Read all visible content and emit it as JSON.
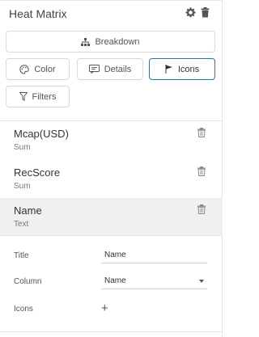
{
  "panel": {
    "title": "Heat Matrix",
    "header_icons": [
      "gear-icon",
      "trash-icon"
    ]
  },
  "buttons": {
    "breakdown": {
      "label": "Breakdown",
      "icon": "hierarchy-icon"
    },
    "color": {
      "label": "Color",
      "icon": "palette-icon"
    },
    "details": {
      "label": "Details",
      "icon": "comment-icon"
    },
    "icons": {
      "label": "Icons",
      "icon": "flag-icon",
      "active": true
    },
    "filters": {
      "label": "Filters",
      "icon": "filter-icon"
    }
  },
  "items": [
    {
      "name": "Mcap(USD)",
      "sub": "Sum"
    },
    {
      "name": "RecScore",
      "sub": "Sum"
    },
    {
      "name": "Name",
      "sub": "Text",
      "selected": true
    }
  ],
  "settings": {
    "title_label": "Title",
    "title_value": "Name",
    "column_label": "Column",
    "column_value": "Name",
    "icons_label": "Icons",
    "add_symbol": "+"
  },
  "colors": {
    "active_border": "#3d6e8c",
    "selected_row": "#eef0f2"
  }
}
